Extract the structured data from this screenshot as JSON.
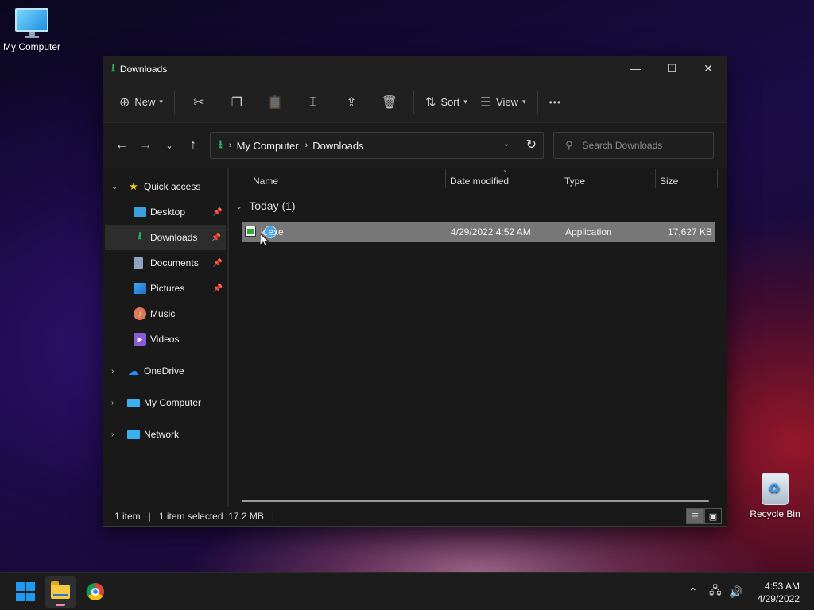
{
  "desktop": {
    "my_computer_label": "My Computer",
    "recycle_bin_label": "Recycle Bin"
  },
  "window": {
    "title": "Downloads",
    "controls": {
      "minimize": "—",
      "maximize": "☐",
      "close": "✕"
    }
  },
  "toolbar": {
    "new_label": "New",
    "sort_label": "Sort",
    "view_label": "View",
    "more_label": "•••",
    "icons": [
      "plus-icon",
      "cut-icon",
      "copy-icon",
      "paste-icon",
      "rename-icon",
      "share-icon",
      "delete-icon",
      "sort-icon",
      "view-icon",
      "more-icon"
    ]
  },
  "address": {
    "crumbs": [
      "My Computer",
      "Downloads"
    ]
  },
  "search": {
    "placeholder": "Search Downloads"
  },
  "sidebar": {
    "quick_access": "Quick access",
    "items": [
      {
        "label": "Desktop",
        "icon": "desktop-icon",
        "pinned": true
      },
      {
        "label": "Downloads",
        "icon": "download-icon",
        "pinned": true,
        "selected": true
      },
      {
        "label": "Documents",
        "icon": "documents-icon",
        "pinned": true
      },
      {
        "label": "Pictures",
        "icon": "pictures-icon",
        "pinned": true
      },
      {
        "label": "Music",
        "icon": "music-icon",
        "pinned": false
      },
      {
        "label": "Videos",
        "icon": "videos-icon",
        "pinned": false
      }
    ],
    "onedrive": "OneDrive",
    "my_computer": "My Computer",
    "network": "Network"
  },
  "columns": {
    "name": "Name",
    "date_modified": "Date modified",
    "type": "Type",
    "size": "Size"
  },
  "group": {
    "label": "Today (1)"
  },
  "files": [
    {
      "name": "k.exe",
      "date_modified": "4/29/2022 4:52 AM",
      "type": "Application",
      "size": "17,627 KB"
    }
  ],
  "status": {
    "count": "1 item",
    "selection": "1 item selected  17.2 MB"
  },
  "taskbar": {
    "time": "4:53 AM",
    "date": "4/29/2022"
  },
  "colors": {
    "accent_green": "#29b56a",
    "selection_row": "#777777",
    "windows_blue": "#1e9bf0"
  }
}
